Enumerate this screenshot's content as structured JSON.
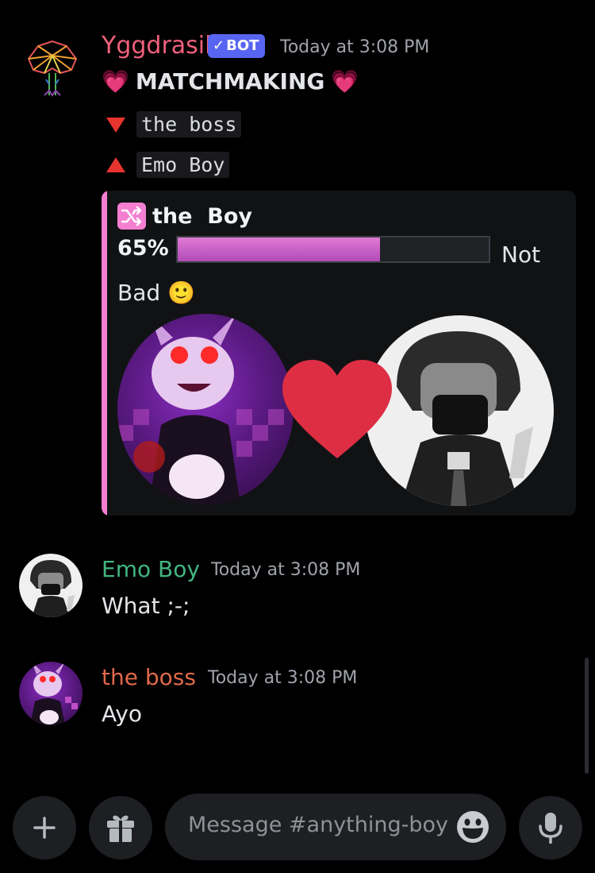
{
  "messages": [
    {
      "username": "Yggdrasil",
      "username_color": "#f0607c",
      "badge": "BOT",
      "timestamp": "Today at 3:08 PM",
      "lines": {
        "header": "MATCHMAKING",
        "header_emoji": "💗",
        "down_name": "the boss",
        "up_name": "Emo Boy"
      },
      "embed": {
        "accent_color": "#f47fd1",
        "title": "the  Boy",
        "percent": "65%",
        "progress_fraction": 0.65,
        "verdict": "Not Bad",
        "verdict_emoji": "🙂",
        "heart_color": "#dd2e44"
      }
    },
    {
      "username": "Emo Boy",
      "username_color": "#43b581",
      "timestamp": "Today at 3:08 PM",
      "text": "What ;-;"
    },
    {
      "username": "the boss",
      "username_color": "#e0694a",
      "timestamp": "Today at 3:08 PM",
      "text": "Ayo"
    }
  ],
  "composer": {
    "placeholder": "Message #anything-boy",
    "add_icon": "plus-icon",
    "gift_icon": "gift-icon",
    "emoji_icon": "emoji-icon",
    "mic_icon": "microphone-icon"
  }
}
